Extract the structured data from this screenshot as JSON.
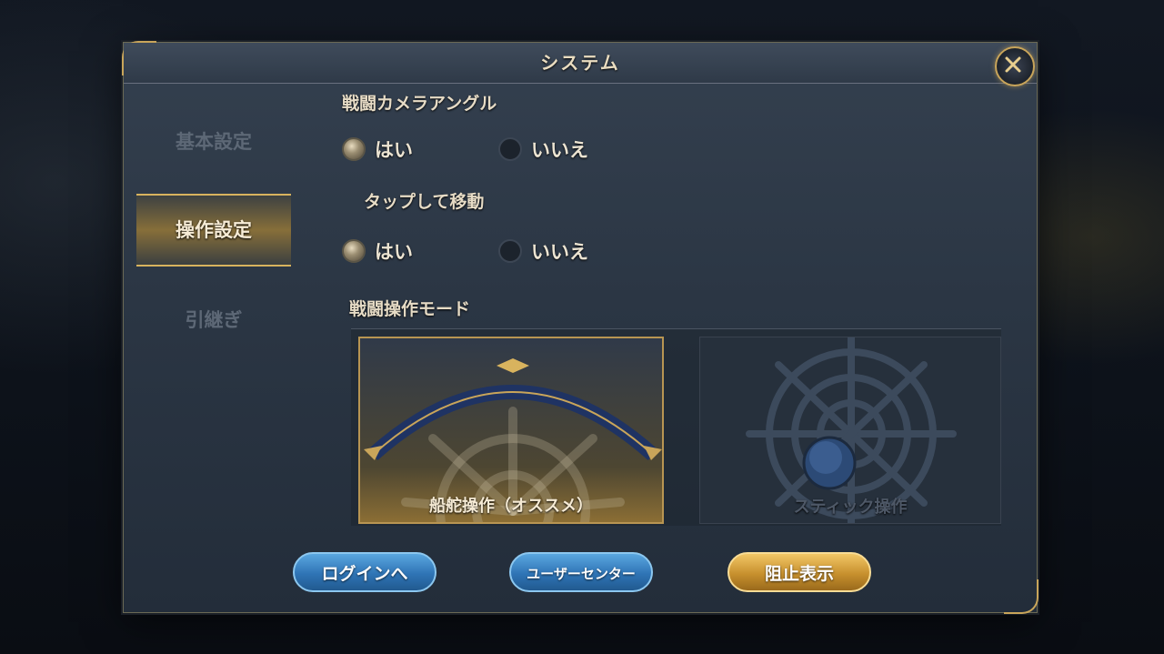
{
  "dialog": {
    "title": "システム",
    "close_icon": "close-icon"
  },
  "sidebar": {
    "items": [
      {
        "label": "基本設定",
        "active": false
      },
      {
        "label": "操作設定",
        "active": true
      },
      {
        "label": "引継ぎ",
        "active": false
      }
    ]
  },
  "settings": {
    "camera_angle": {
      "label": "戦闘カメラアングル",
      "options": [
        {
          "label": "はい",
          "selected": true
        },
        {
          "label": "いいえ",
          "selected": false
        }
      ]
    },
    "tap_move": {
      "label": "タップして移動",
      "options": [
        {
          "label": "はい",
          "selected": true
        },
        {
          "label": "いいえ",
          "selected": false
        }
      ]
    },
    "battle_mode": {
      "label": "戦闘操作モード",
      "options": [
        {
          "label": "船舵操作（オススメ）",
          "selected": true,
          "icon": "ship-wheel-icon"
        },
        {
          "label": "スティック操作",
          "selected": false,
          "icon": "joystick-icon"
        }
      ]
    }
  },
  "buttons": {
    "login": "ログインへ",
    "user_center": "ユーザーセンター",
    "block_list": "阻止表示"
  },
  "colors": {
    "accent_gold": "#c9a55a",
    "button_blue": "#2f74b5",
    "button_gold": "#c7902e"
  }
}
